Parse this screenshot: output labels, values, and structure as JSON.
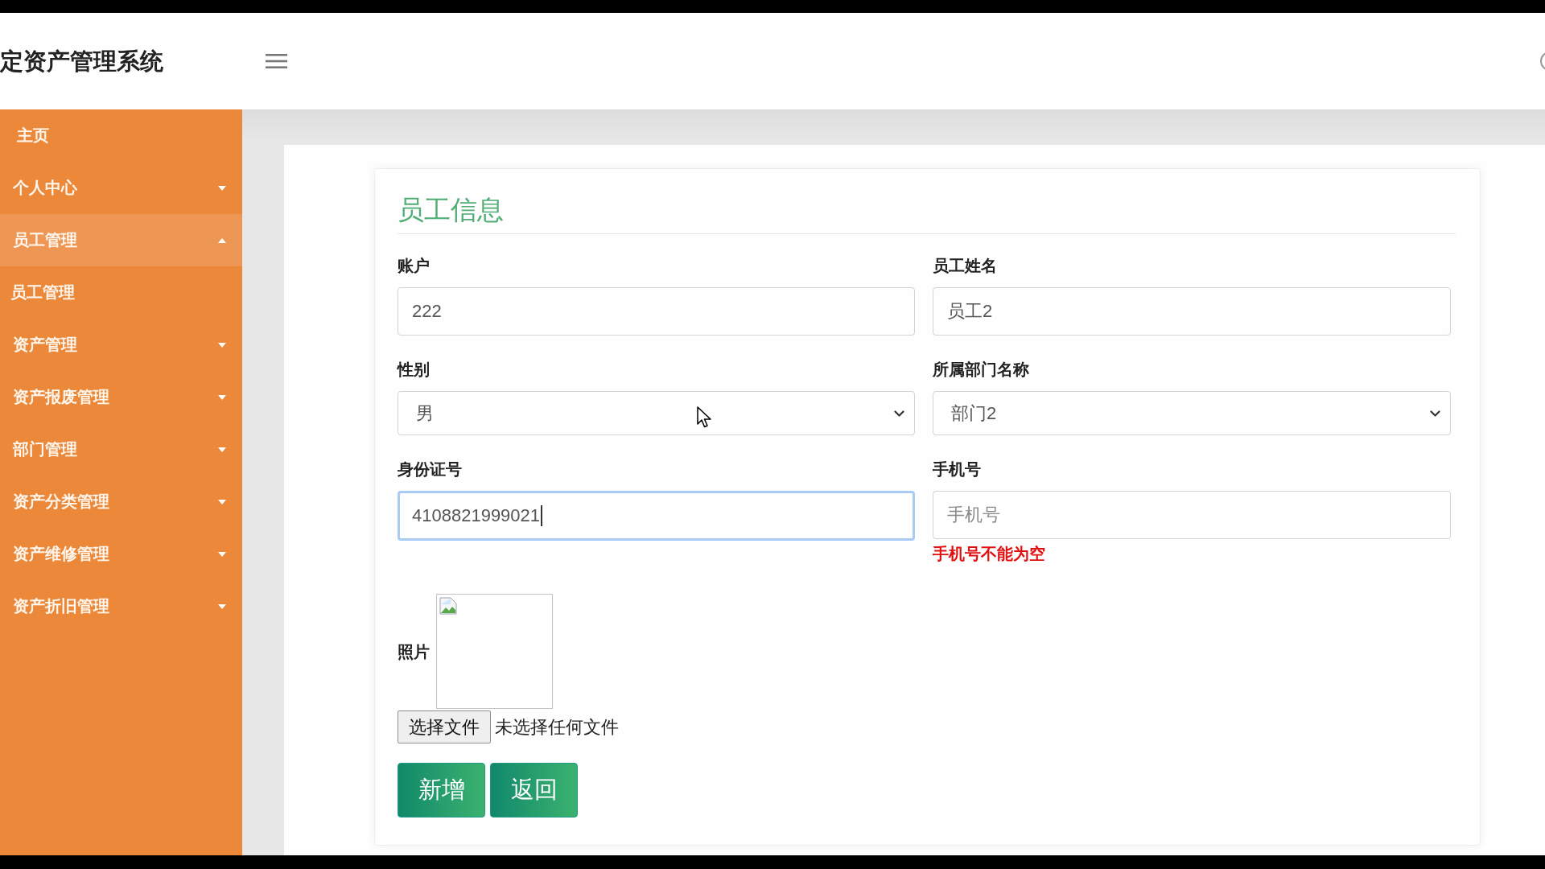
{
  "header": {
    "title": "定资产管理系统"
  },
  "sidebar": {
    "items": [
      {
        "label": "主页",
        "kind": "link"
      },
      {
        "label": "个人中心",
        "kind": "group",
        "expanded": false
      },
      {
        "label": "员工管理",
        "kind": "group",
        "expanded": true,
        "children": [
          {
            "label": "员工管理"
          }
        ]
      },
      {
        "label": "资产管理",
        "kind": "group",
        "expanded": false
      },
      {
        "label": "资产报废管理",
        "kind": "group",
        "expanded": false
      },
      {
        "label": "部门管理",
        "kind": "group",
        "expanded": false
      },
      {
        "label": "资产分类管理",
        "kind": "group",
        "expanded": false
      },
      {
        "label": "资产维修管理",
        "kind": "group",
        "expanded": false
      },
      {
        "label": "资产折旧管理",
        "kind": "group",
        "expanded": false
      }
    ]
  },
  "form": {
    "title": "员工信息",
    "fields": [
      {
        "kind": "text",
        "label": "账户",
        "value": "222",
        "focused": false
      },
      {
        "kind": "text",
        "label": "员工姓名",
        "value": "员工2",
        "focused": false
      },
      {
        "kind": "select",
        "label": "性别",
        "value": "男",
        "focused": false
      },
      {
        "kind": "select",
        "label": "所属部门名称",
        "value": "部门2",
        "focused": false
      },
      {
        "kind": "text",
        "label": "身份证号",
        "value": "4108821999021",
        "focused": true
      },
      {
        "kind": "text",
        "label": "手机号",
        "placeholder": "手机号",
        "focused": false,
        "error": "手机号不能为空"
      }
    ],
    "photo": {
      "label": "照片",
      "file_button": "选择文件",
      "file_status": "未选择任何文件"
    },
    "buttons": [
      {
        "label": "新增"
      },
      {
        "label": "返回"
      }
    ]
  }
}
